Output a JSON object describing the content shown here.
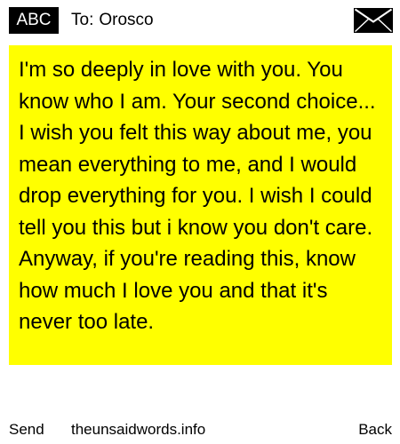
{
  "header": {
    "mode_label": "ABC",
    "to_label": "To:",
    "recipient": "Orosco",
    "envelope_icon": "envelope-icon"
  },
  "message": {
    "body": "I'm so deeply in love with you. You know who I am. Your second choice... I wish you felt this way about me, you mean everything to me, and I would drop everything for you. I wish I could tell you this but i know you don't care. Anyway, if you're reading this, know how much I love you and that it's never too late."
  },
  "footer": {
    "send_label": "Send",
    "site_label": "theunsaidwords.info",
    "back_label": "Back"
  },
  "colors": {
    "message_background": "#ffff00",
    "badge_background": "#000000",
    "badge_text": "#ffffff"
  }
}
